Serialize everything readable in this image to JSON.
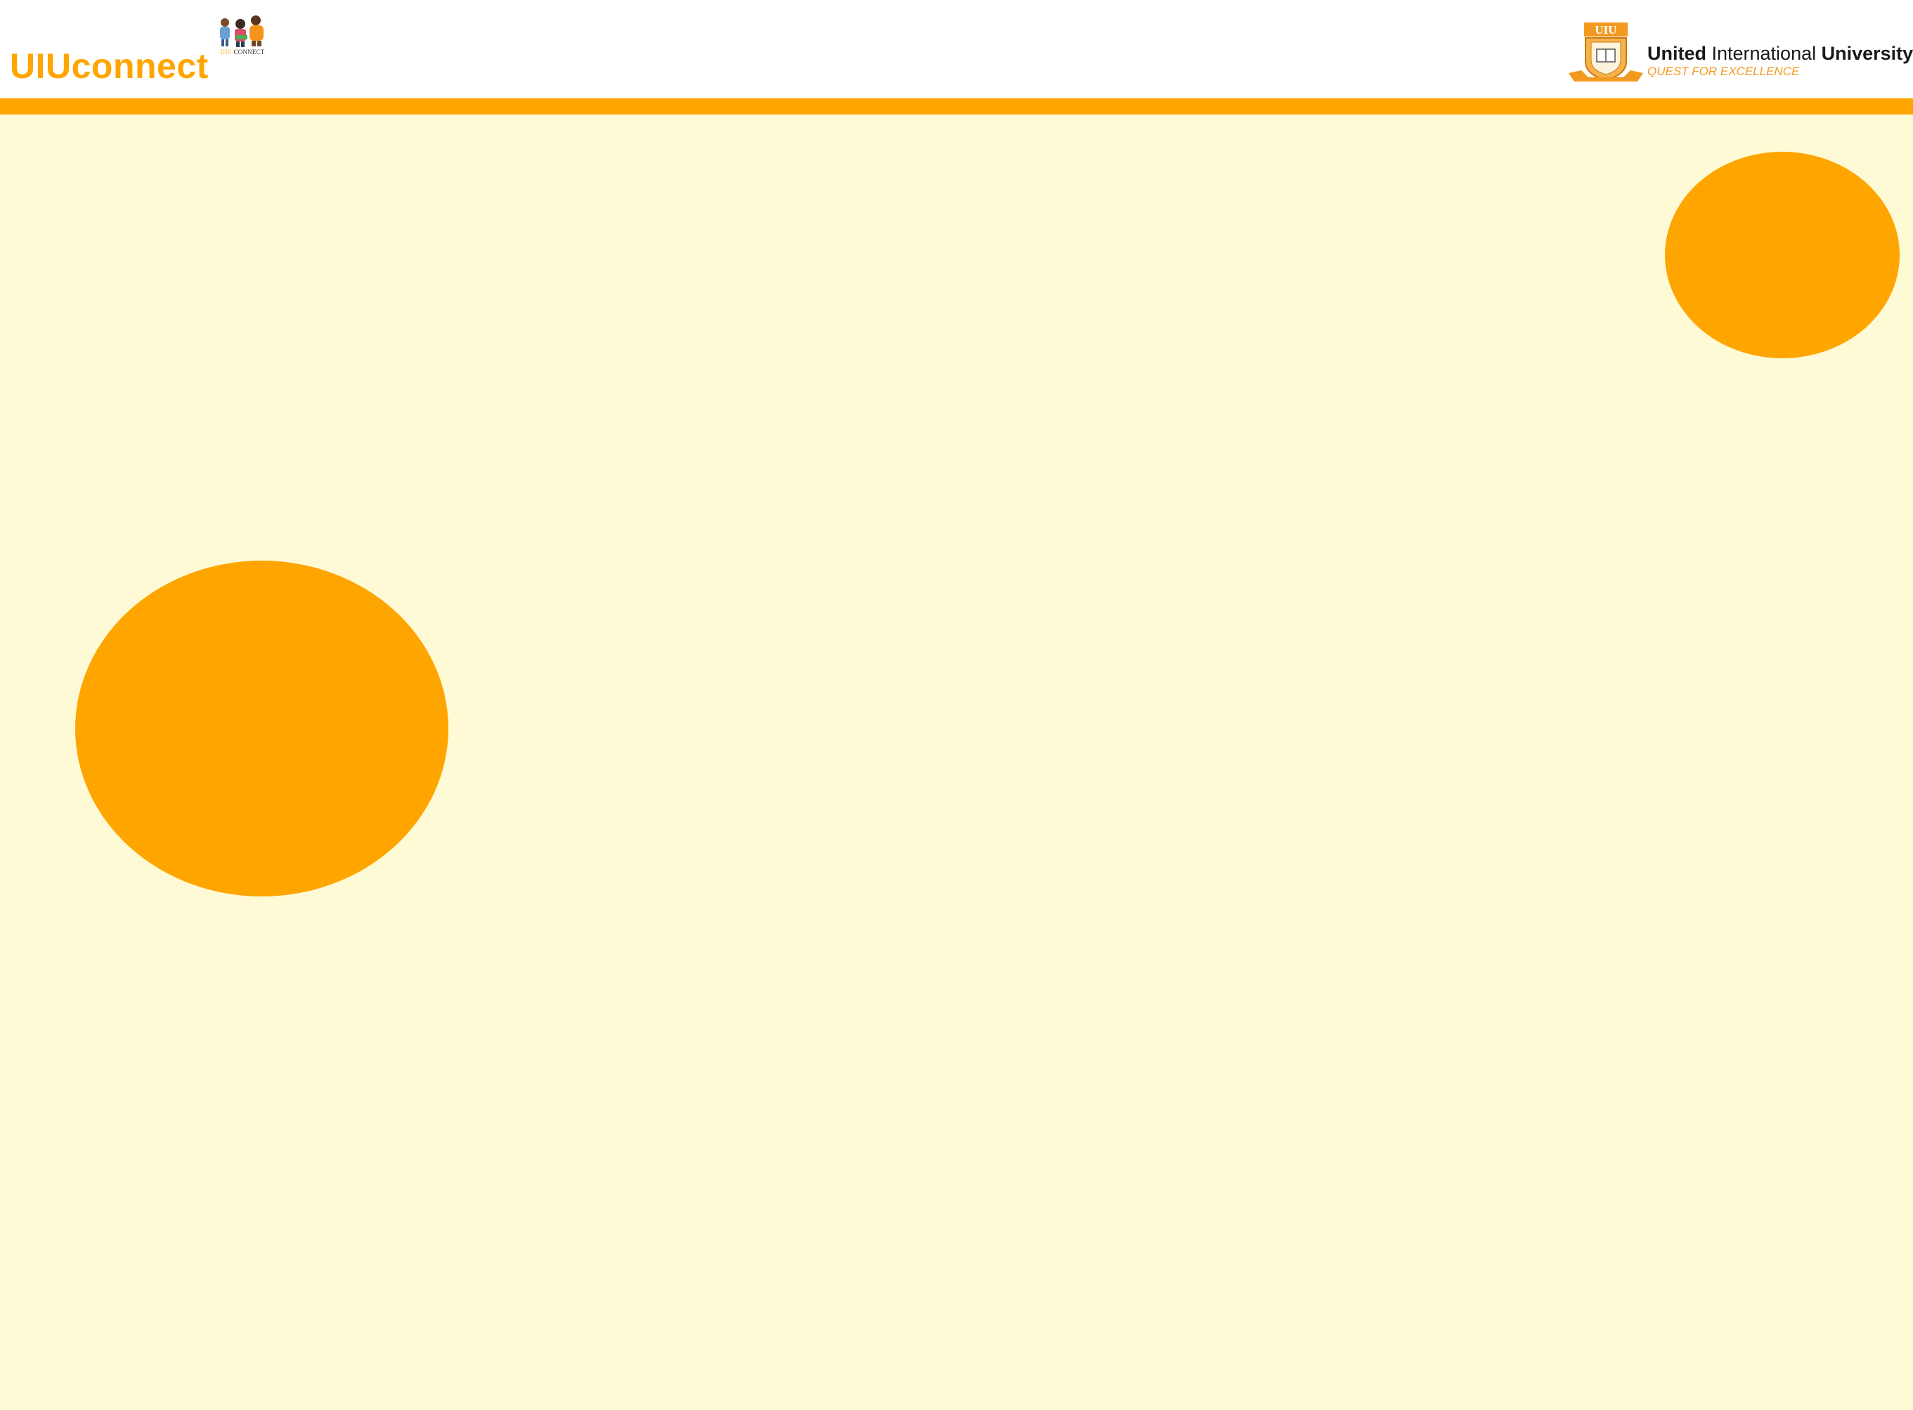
{
  "header": {
    "brand_title": "UIUconnect",
    "brand_logo_caption_prefix": "UIU",
    "brand_logo_caption_suffix": "CONNECT",
    "university_name_part1": "United",
    "university_name_part2": " International ",
    "university_name_part3": "University",
    "university_tagline": "QUEST FOR EXCELLENCE",
    "university_crest_text": "UIU"
  },
  "colors": {
    "accent": "#FFA500",
    "background": "#FFFAD6",
    "header_background": "#FFFFFF",
    "tagline": "#F29A1F"
  },
  "icons": {
    "brand_logo": "students-illustration-icon",
    "university_logo": "university-crest-icon"
  }
}
